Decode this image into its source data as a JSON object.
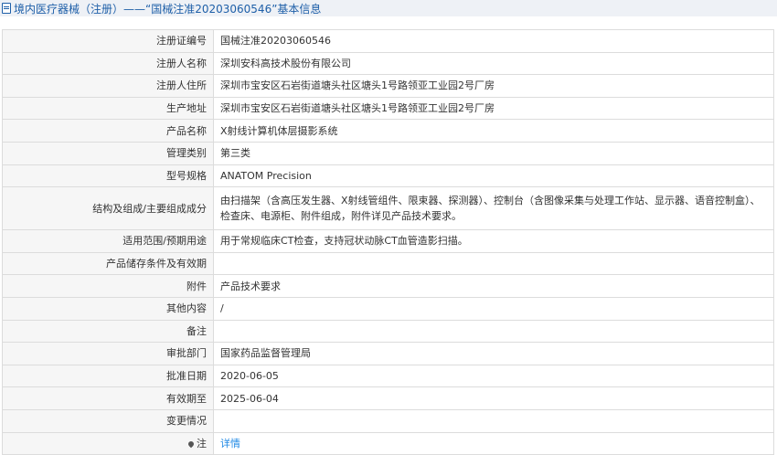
{
  "header": {
    "title": "境内医疗器械（注册）——“国械注准20203060546”基本信息"
  },
  "rows": [
    {
      "label": "注册证编号",
      "value": "国械注准20203060546"
    },
    {
      "label": "注册人名称",
      "value": "深圳安科高技术股份有限公司"
    },
    {
      "label": "注册人住所",
      "value": "深圳市宝安区石岩街道塘头社区塘头1号路领亚工业园2号厂房"
    },
    {
      "label": "生产地址",
      "value": "深圳市宝安区石岩街道塘头社区塘头1号路领亚工业园2号厂房"
    },
    {
      "label": "产品名称",
      "value": "X射线计算机体层摄影系统"
    },
    {
      "label": "管理类别",
      "value": "第三类"
    },
    {
      "label": "型号规格",
      "value": "ANATOM Precision"
    },
    {
      "label": "结构及组成/主要组成成分",
      "value": "由扫描架（含高压发生器、X射线管组件、限束器、探测器）、控制台（含图像采集与处理工作站、显示器、语音控制盒）、检查床、电源柜、附件组成，附件详见产品技术要求。"
    },
    {
      "label": "适用范围/预期用途",
      "value": "用于常规临床CT检查，支持冠状动脉CT血管造影扫描。"
    },
    {
      "label": "产品储存条件及有效期",
      "value": ""
    },
    {
      "label": "附件",
      "value": "产品技术要求"
    },
    {
      "label": "其他内容",
      "value": "/"
    },
    {
      "label": "备注",
      "value": ""
    },
    {
      "label": "审批部门",
      "value": "国家药品监督管理局"
    },
    {
      "label": "批准日期",
      "value": "2020-06-05"
    },
    {
      "label": "有效期至",
      "value": "2025-06-04"
    },
    {
      "label": "变更情况",
      "value": ""
    },
    {
      "label": "注",
      "value": "详情"
    }
  ]
}
